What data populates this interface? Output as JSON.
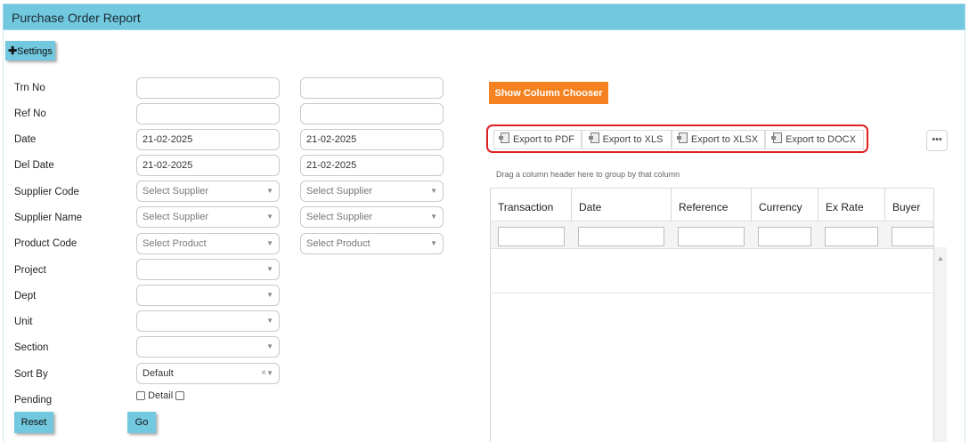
{
  "title": "Purchase Order Report",
  "settings_label": "Settings",
  "form": {
    "trn_no": "Trn No",
    "ref_no": "Ref No",
    "date": "Date",
    "date_from": "21-02-2025",
    "date_to": "21-02-2025",
    "del_date": "Del Date",
    "del_date_from": "21-02-2025",
    "del_date_to": "21-02-2025",
    "supplier_code": "Supplier Code",
    "supplier_name": "Supplier Name",
    "product_code": "Product Code",
    "select_supplier": "Select Supplier",
    "select_product": "Select Product",
    "project": "Project",
    "dept": "Dept",
    "unit": "Unit",
    "section": "Section",
    "sort_by": "Sort By",
    "sort_value": "Default",
    "pending": "Pending",
    "detail": "Detail",
    "reset": "Reset",
    "go": "Go"
  },
  "toolbar": {
    "column_chooser": "Show Column Chooser",
    "export_pdf": "Export to PDF",
    "export_xls": "Export to XLS",
    "export_xlsx": "Export to XLSX",
    "export_docx": "Export to DOCX",
    "more": "•••"
  },
  "grid": {
    "group_hint": "Drag a column header here to group by that column",
    "columns": [
      "Transaction",
      "Date",
      "Reference",
      "Currency",
      "Ex Rate",
      "Buyer"
    ]
  },
  "icons": {
    "settings": "plus-icon",
    "export": "document-icon",
    "dropdown": "chevron-down-icon",
    "scroll": "arrow-up-icon"
  }
}
